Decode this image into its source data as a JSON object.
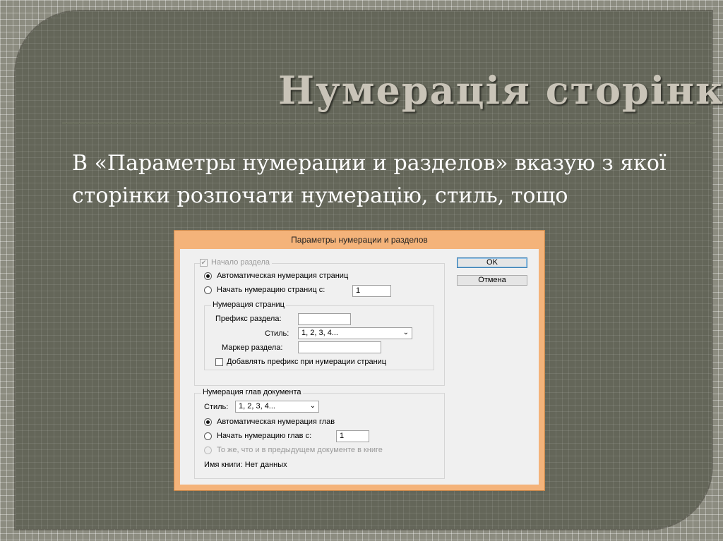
{
  "slide": {
    "title": "Нумерація сторінки",
    "body": "В «Параметры нумерации и разделов» вказую з якої сторінки розпочати нумерацію, стиль, тощо"
  },
  "dialog": {
    "title": "Параметры нумерации и разделов",
    "ok_label": "OK",
    "cancel_label": "Отмена",
    "section_start_label": "Начало раздела",
    "auto_page_numbering_label": "Автоматическая нумерация страниц",
    "start_page_numbering_label": "Начать нумерацию страниц с:",
    "start_page_value": "1",
    "page_numbering_group": {
      "legend": "Нумерация страниц",
      "prefix_label": "Префикс раздела:",
      "prefix_value": "",
      "style_label": "Стиль:",
      "style_value": "1, 2, 3, 4...",
      "marker_label": "Маркер раздела:",
      "marker_value": "",
      "add_prefix_label": "Добавлять префикс при нумерации страниц"
    },
    "chapter_group": {
      "legend": "Нумерация глав документа",
      "style_label": "Стиль:",
      "style_value": "1, 2, 3, 4...",
      "auto_chapter_label": "Автоматическая нумерация глав",
      "start_chapter_label": "Начать нумерацию глав с:",
      "start_chapter_value": "1",
      "same_as_prev_label": "То же, что и в предыдущем документе в книге",
      "book_name_label": "Имя книги: Нет данных"
    }
  }
}
